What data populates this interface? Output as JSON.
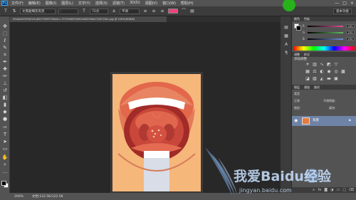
{
  "app": {
    "logo": "Ps"
  },
  "menubar": {
    "items": [
      "文件(F)",
      "编辑(E)",
      "图像(I)",
      "图层(L)",
      "文字(Y)",
      "选择(S)",
      "滤镜(T)",
      "3D(D)",
      "视图(V)",
      "窗口(W)",
      "帮助(H)"
    ],
    "window_controls": [
      "—",
      "□",
      "×"
    ]
  },
  "options_bar": {
    "font_family": "文鼎超细黑黑黑",
    "font_style": "-",
    "font_size": "72点",
    "anti_alias": "平滑",
    "workspace": "基本功能"
  },
  "document_tab": {
    "title": "00c8e02093401f1c80273563726b0c1-7f72946f2f5d924d4f293ab7316720ec.jpg @ 200%(RGB/8)"
  },
  "status_bar": {
    "zoom": "200%",
    "doc_info": "文档:122.5K/122.5K"
  },
  "color_panel": {
    "tabs": [
      "颜色",
      "色板"
    ],
    "sliders": [
      {
        "label": "R",
        "value": "255",
        "color": "#e4509a"
      },
      {
        "label": "G",
        "value": "255",
        "color": "#5dc060"
      },
      {
        "label": "B",
        "value": "255",
        "color": "#6a8fe0"
      }
    ]
  },
  "adjustments_panel": {
    "tabs": [
      "调整",
      "样式"
    ],
    "label": "添加调整"
  },
  "layers_panel": {
    "tabs": [
      "图层",
      "通道",
      "路径"
    ],
    "kind_label": "类型",
    "blend_mode": "正常",
    "opacity_label": "不透明度:",
    "lock_label": "锁定:",
    "fill_label": "填充:",
    "layer_name": "背景"
  },
  "watermark": {
    "text": "我爱Baidu经验",
    "url": "jingyan.baidu.com"
  },
  "colors": {
    "accent_pink": "#e8457a",
    "layer_selected": "#6f83a6",
    "badge_green": "#27b11a"
  }
}
